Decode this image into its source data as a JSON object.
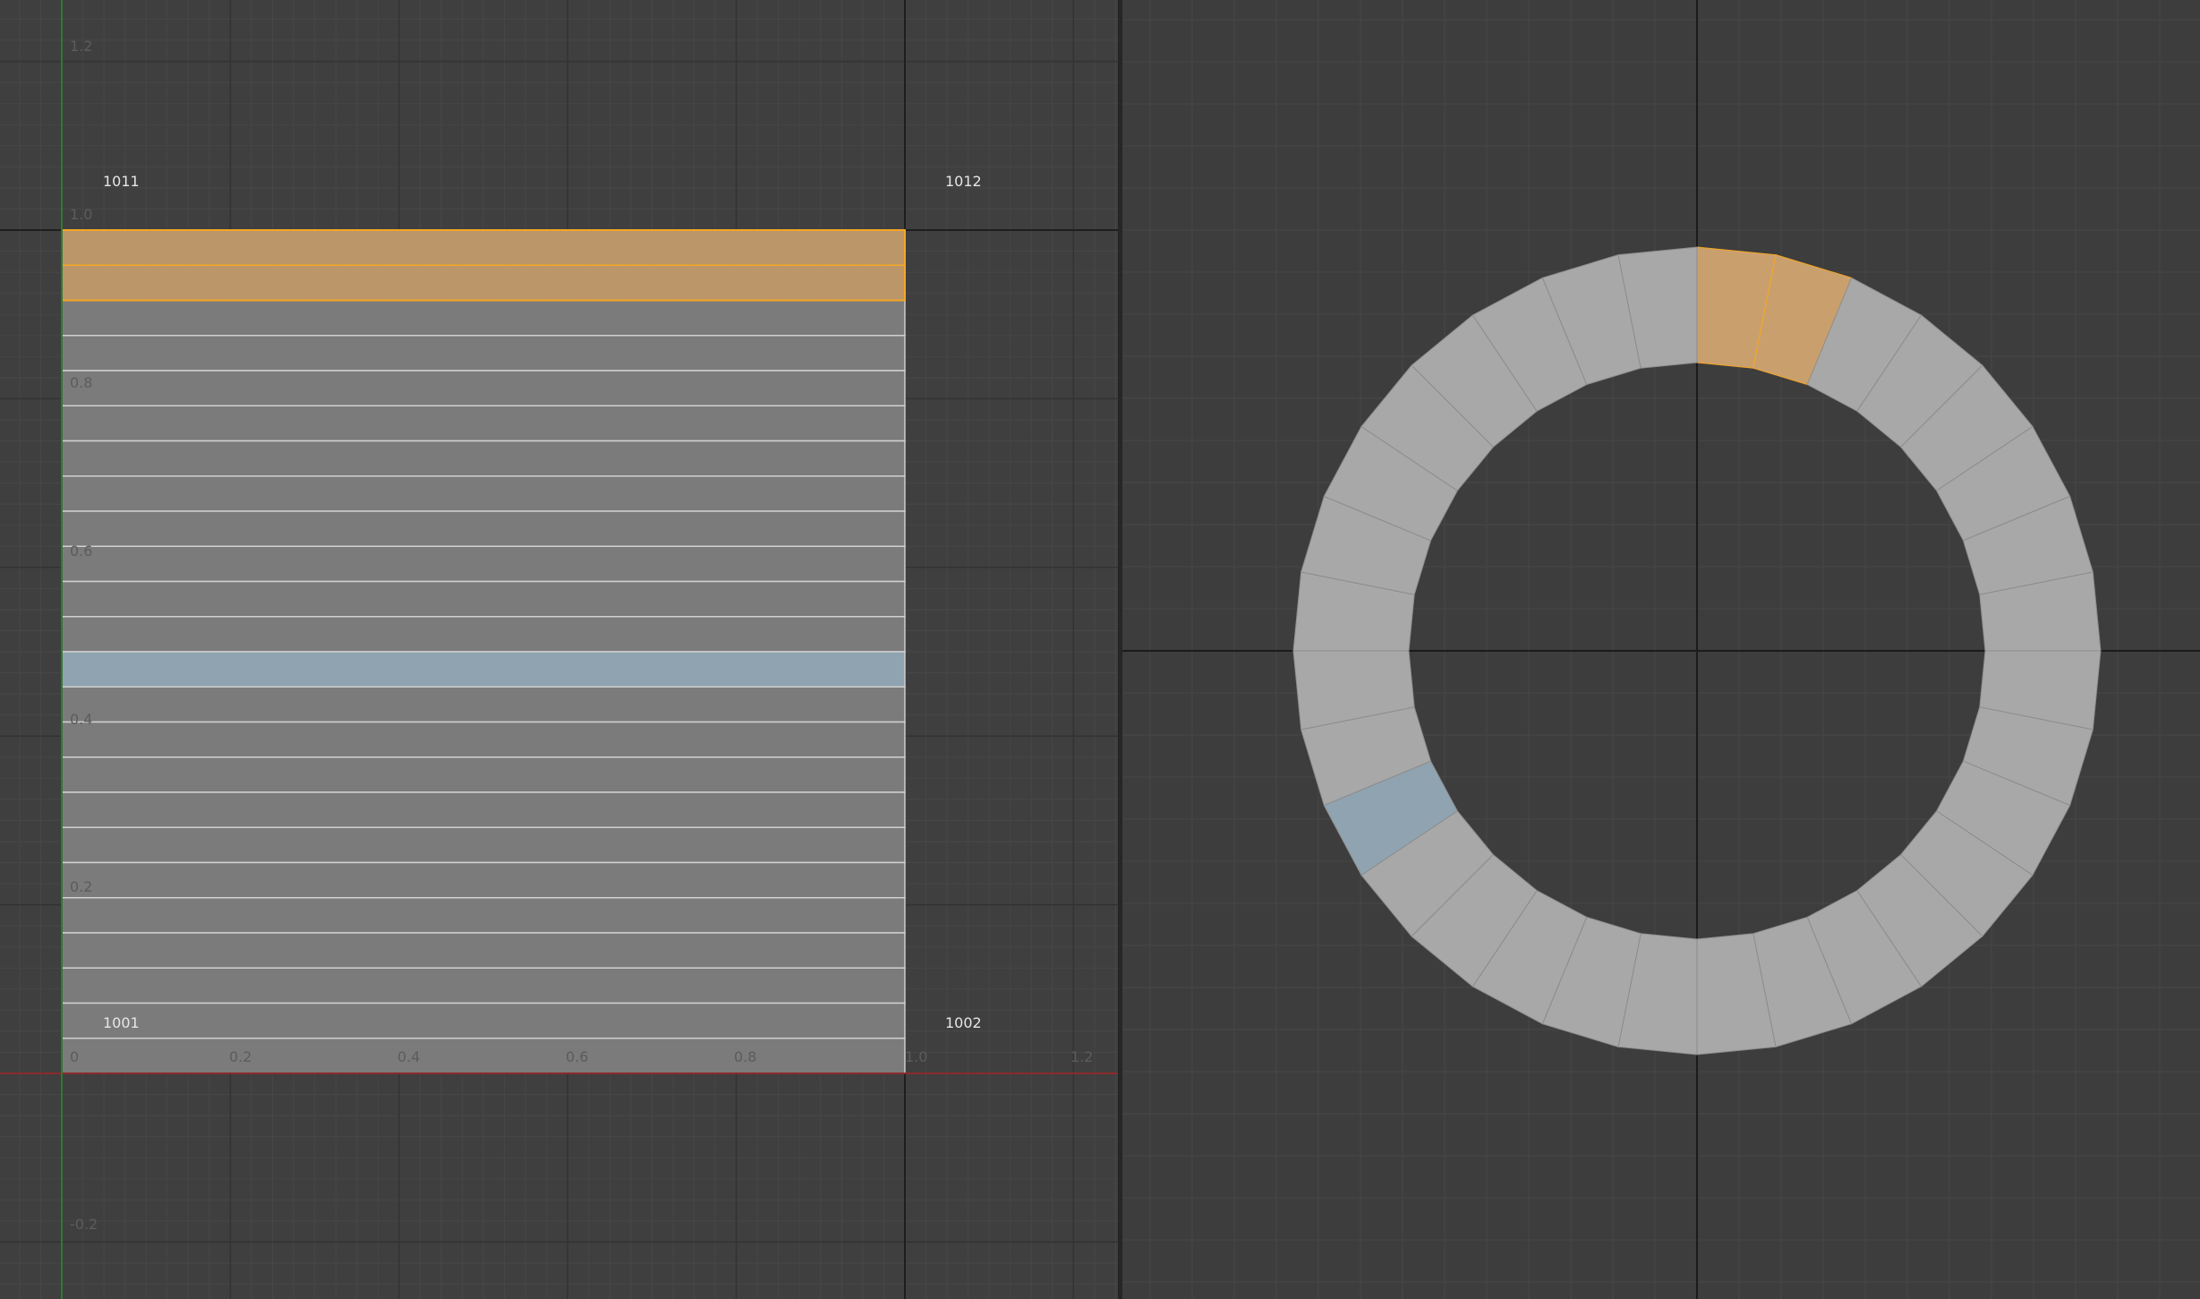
{
  "uv_editor": {
    "v_ticks": [
      "1.2",
      "1.0",
      "0.8",
      "0.6",
      "0.4",
      "0.2",
      "-0.2"
    ],
    "u_ticks": [
      "0",
      "0.2",
      "0.4",
      "0.6",
      "0.8",
      "1.0",
      "1.2"
    ],
    "tiles": [
      "1011",
      "1012",
      "1001",
      "1002"
    ],
    "strip_count": 24,
    "selected_strips": [
      0,
      1
    ],
    "active_strip": 12
  },
  "viewport": {
    "ring_segments": 32,
    "selected_faces": [
      0,
      1
    ],
    "active_face": 21
  },
  "colors": {
    "background": "#3f3f3f",
    "grid_major": "#333333",
    "grid_minor": "#474747",
    "uv_face": "#7b7b7b",
    "uv_edge": "#d0d0d0",
    "selected_fill": "#c9a06d",
    "selected_edge": "#f5a623",
    "active_fill": "#8fa3b0",
    "mesh_face": "#a8a8a8",
    "mesh_edge": "#8c8c8c",
    "u_axis": "#8b2a2a",
    "v_axis": "#2f7a2f"
  }
}
